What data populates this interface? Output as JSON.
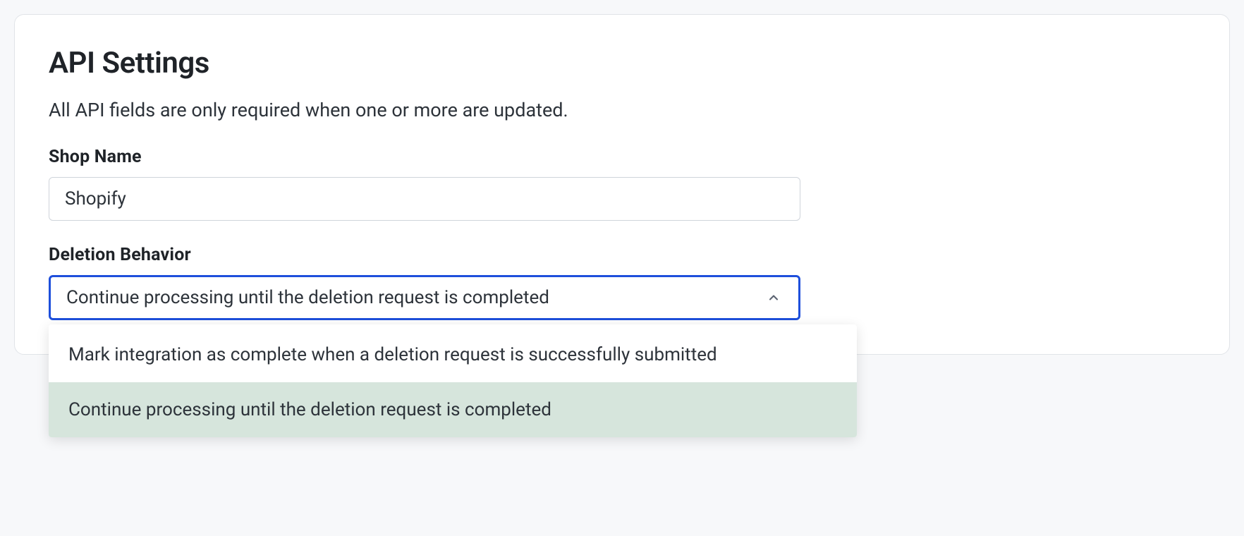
{
  "card": {
    "title": "API Settings",
    "subtitle": "All API fields are only required when one or more are updated."
  },
  "fields": {
    "shopName": {
      "label": "Shop Name",
      "value": "Shopify"
    },
    "deletionBehavior": {
      "label": "Deletion Behavior",
      "selected": "Continue processing until the deletion request is completed",
      "options": [
        "Mark integration as complete when a deletion request is successfully submitted",
        "Continue processing until the deletion request is completed"
      ]
    }
  }
}
